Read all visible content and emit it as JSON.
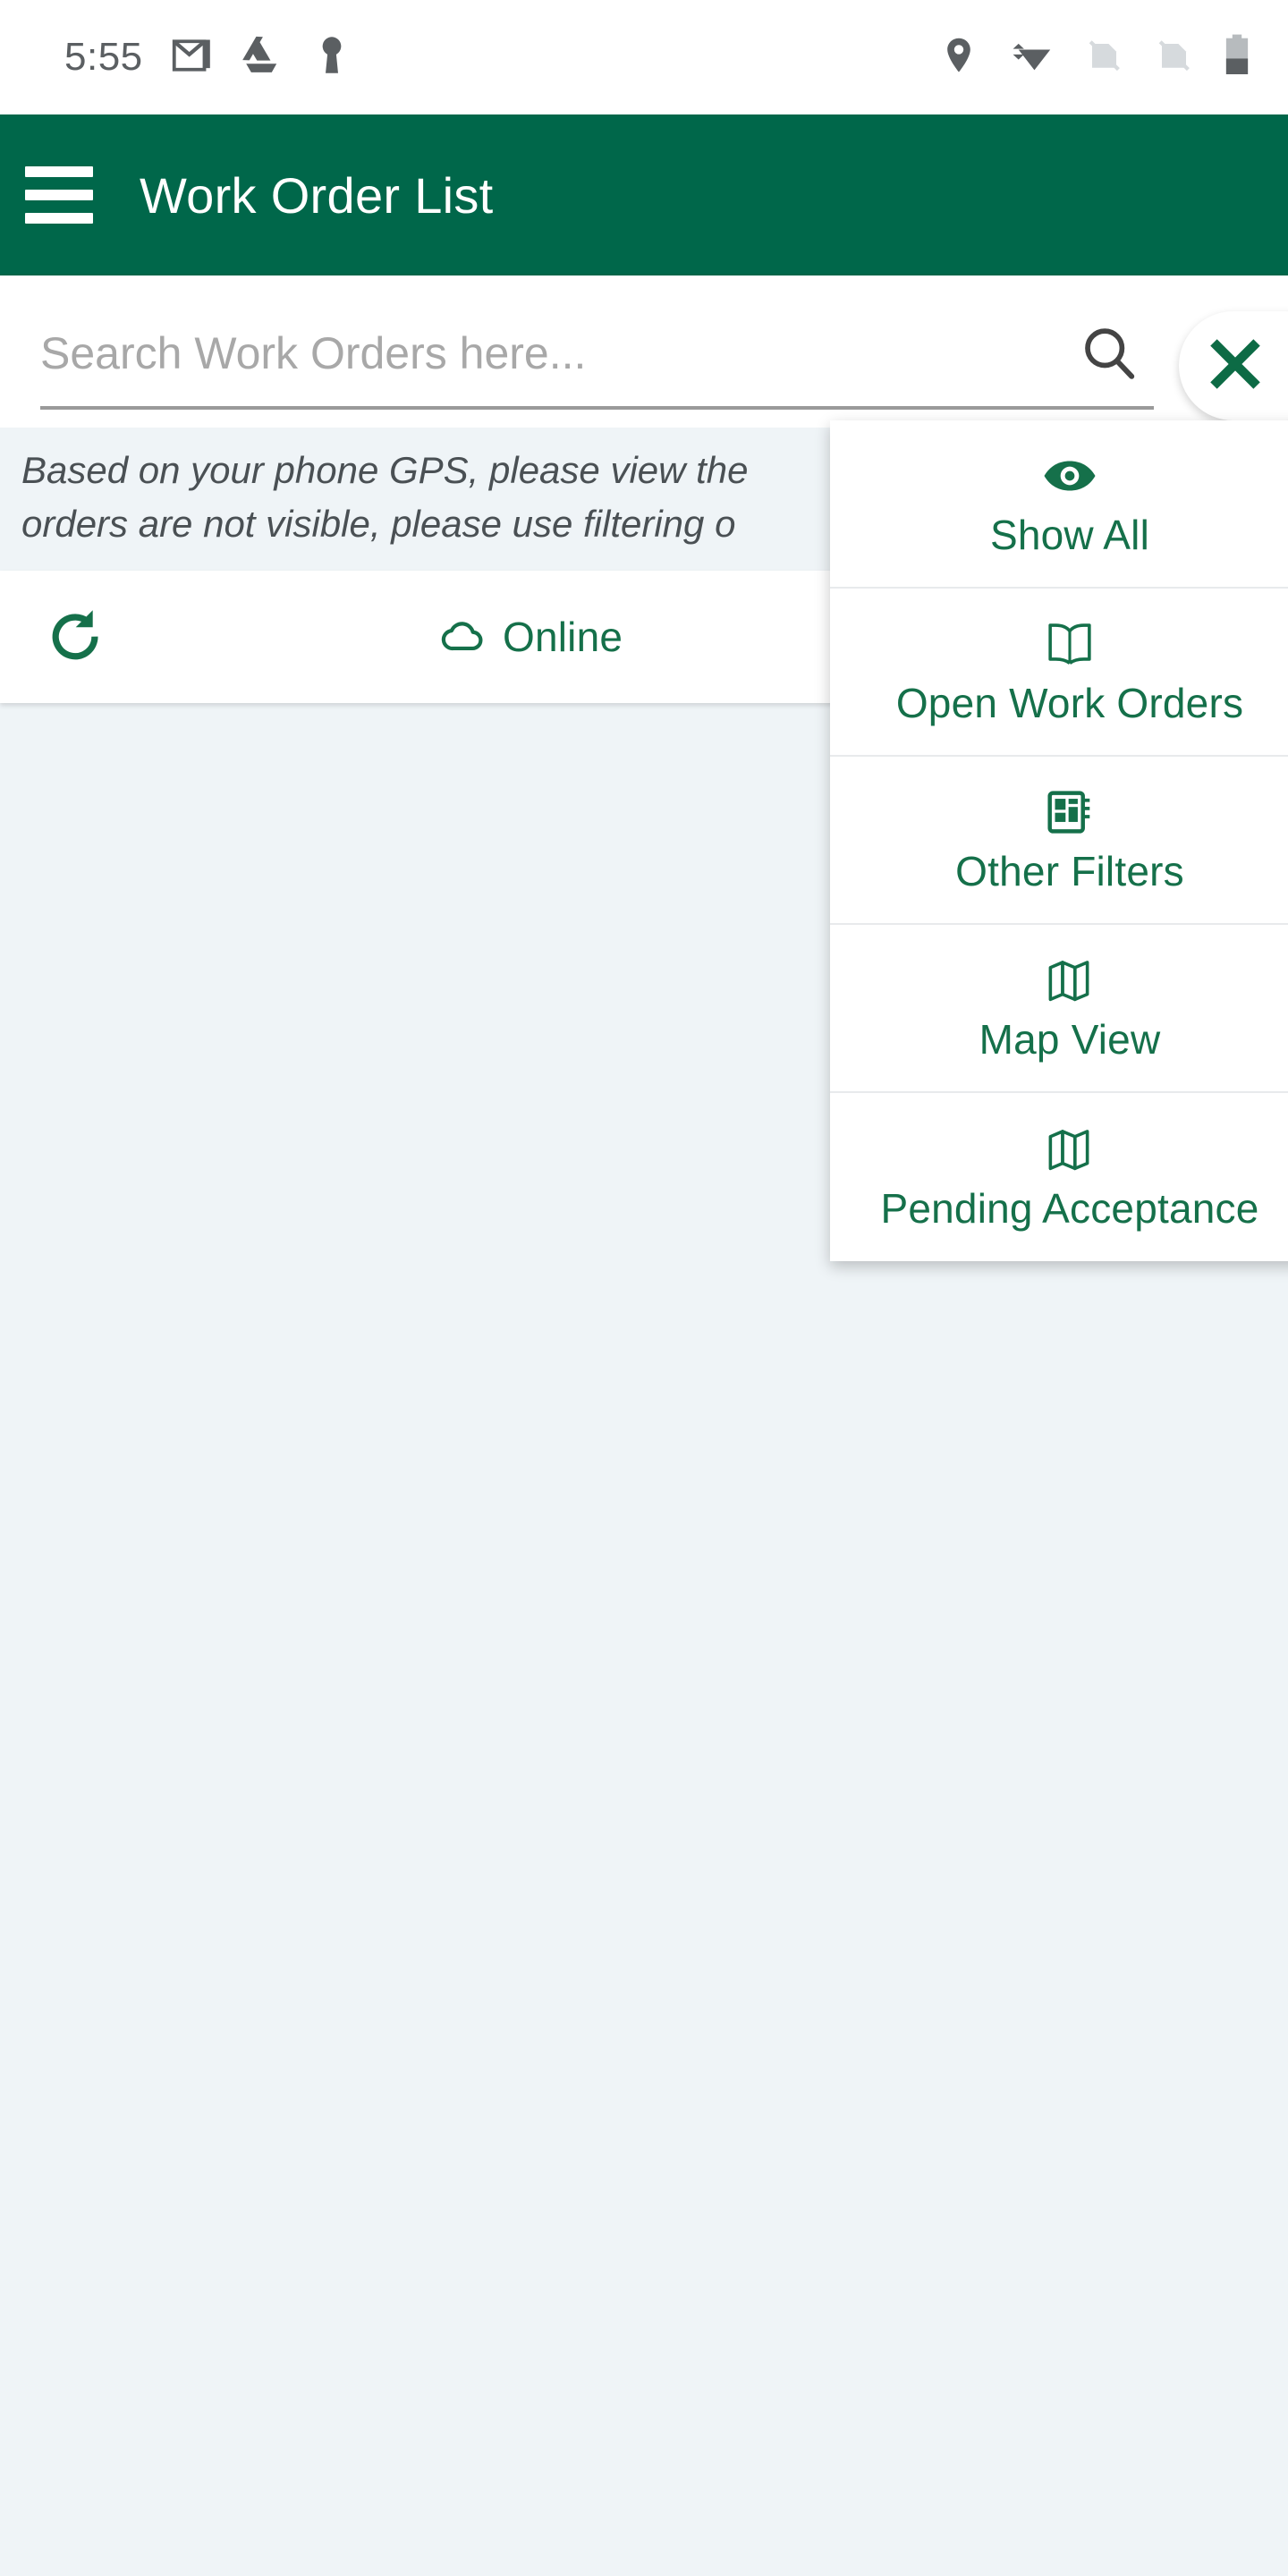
{
  "statusbar": {
    "clock": "5:55",
    "left_icons": [
      "gmail-icon",
      "google-drive-icon",
      "keyhole-icon"
    ],
    "right_icons": [
      "location-pin-icon",
      "wifi-icon",
      "no-sim-1-icon",
      "no-sim-2-icon",
      "battery-icon"
    ]
  },
  "appbar": {
    "menu_icon": "hamburger-menu-icon",
    "title": "Work Order List",
    "background_color": "#00674A",
    "text_color": "#FFFFFF"
  },
  "search": {
    "placeholder": "Search Work Orders here...",
    "value": "",
    "search_icon": "magnifier-icon",
    "close_icon": "close-x-icon",
    "close_color": "#0D6B45"
  },
  "gps_note": {
    "text": "Based on your phone GPS, please view the\norders are not visible, please use filtering o"
  },
  "status_card": {
    "refresh_icon": "refresh-icon",
    "cloud_icon": "cloud-icon",
    "connection_label": "Online",
    "accent_color": "#15704A"
  },
  "dropdown": {
    "items": [
      {
        "label": "Show All",
        "icon": "eye-icon"
      },
      {
        "label": "Open Work Orders",
        "icon": "open-book-icon"
      },
      {
        "label": "Other Filters",
        "icon": "notebook-filter-icon"
      },
      {
        "label": "Map View",
        "icon": "folded-map-icon"
      },
      {
        "label": "Pending Acceptance",
        "icon": "folded-map-icon"
      }
    ]
  },
  "theme": {
    "brand_green": "#00674A",
    "accent_green": "#15704A",
    "page_background": "#EFF4F7",
    "surface": "#FFFFFF"
  }
}
